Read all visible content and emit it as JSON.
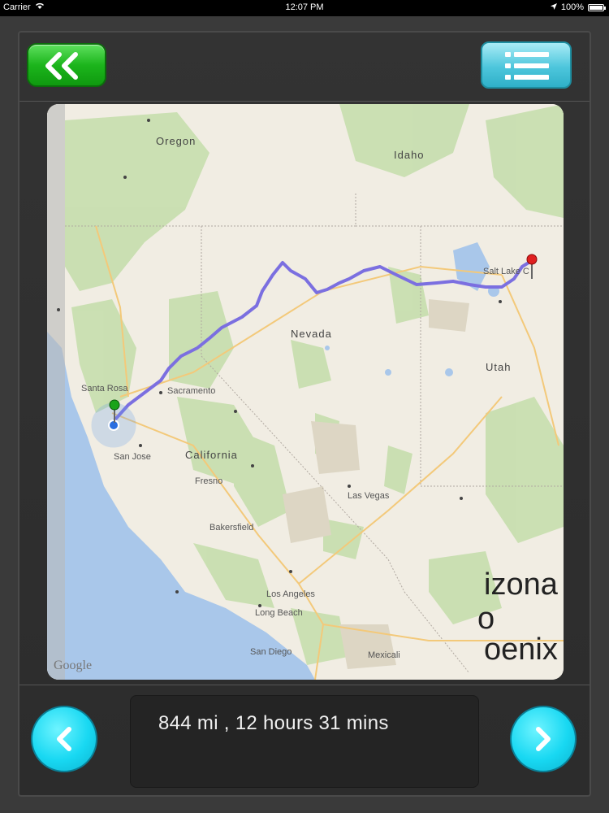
{
  "status_bar": {
    "carrier": "Carrier",
    "time": "12:07 PM",
    "battery": "100%",
    "battery_level": 1.0
  },
  "toolbar": {
    "back_icon": "double-chevron-left-icon",
    "menu_icon": "list-icon"
  },
  "map": {
    "labels": {
      "oregon": "Oregon",
      "idaho": "Idaho",
      "nevada": "Nevada",
      "utah": "Utah",
      "california": "California",
      "sacramento": "Sacramento",
      "san_jose": "San Jose",
      "fresno": "Fresno",
      "bakersfield": "Bakersfield",
      "las_vegas": "Las Vegas",
      "los_angeles": "Los Angeles",
      "long_beach": "Long Beach",
      "san_diego": "San Diego",
      "santa_rosa": "Santa Rosa",
      "salt_lake": "Salt Lake C",
      "mexicali": "Mexicali",
      "arizona": "izona",
      "phoenix_o": "o",
      "phoenix": "oenix"
    },
    "attribution": "Google",
    "colors": {
      "route": "#7b6fe0",
      "start_pin": "#1aa31a",
      "end_pin": "#e02020",
      "water": "#a9c7ea"
    }
  },
  "route_info": {
    "summary": "844 mi , 12 hours 31 mins"
  }
}
